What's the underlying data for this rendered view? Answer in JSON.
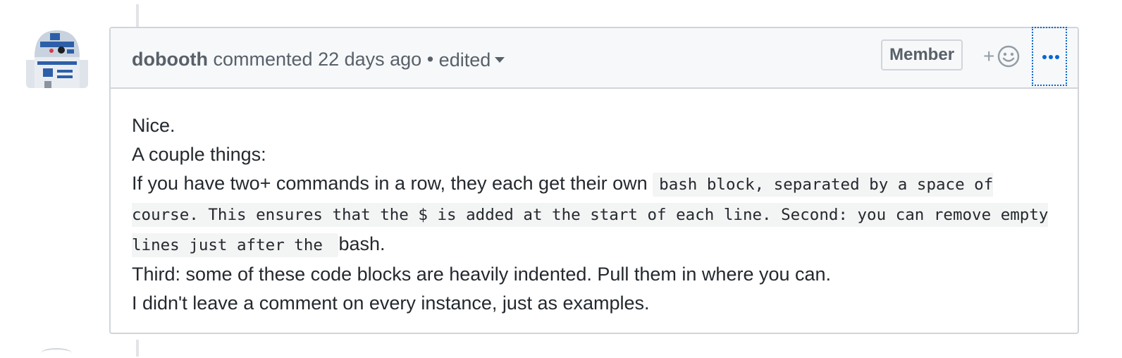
{
  "comment": {
    "author": "dobooth",
    "action": "commented",
    "time": "22 days ago",
    "separator": "•",
    "edited_label": "edited",
    "role_badge": "Member",
    "reaction_plus": "+",
    "body": {
      "line1": "Nice.",
      "line2": "A couple things:",
      "line3_prefix": "If you have two+ commands in a row, they each get their own ",
      "line3_code": "bash block, separated by a space of course. This ensures that the $ is added at the start of each line. Second: you can remove empty lines just after the ",
      "line3_suffix": "bash.",
      "line4": "Third: some of these code blocks are heavily indented. Pull them in where you can.",
      "line5": "I didn't leave a comment on every instance, just as examples."
    }
  },
  "icons": {
    "avatar": "r2d2-avatar",
    "reaction": "smiley-icon",
    "more": "kebab-horizontal-icon",
    "caret": "caret-down-icon"
  },
  "colors": {
    "link_blue": "#0366d6",
    "header_bg": "#f6f8fa",
    "border": "#d1d5da",
    "muted_text": "#586069"
  }
}
